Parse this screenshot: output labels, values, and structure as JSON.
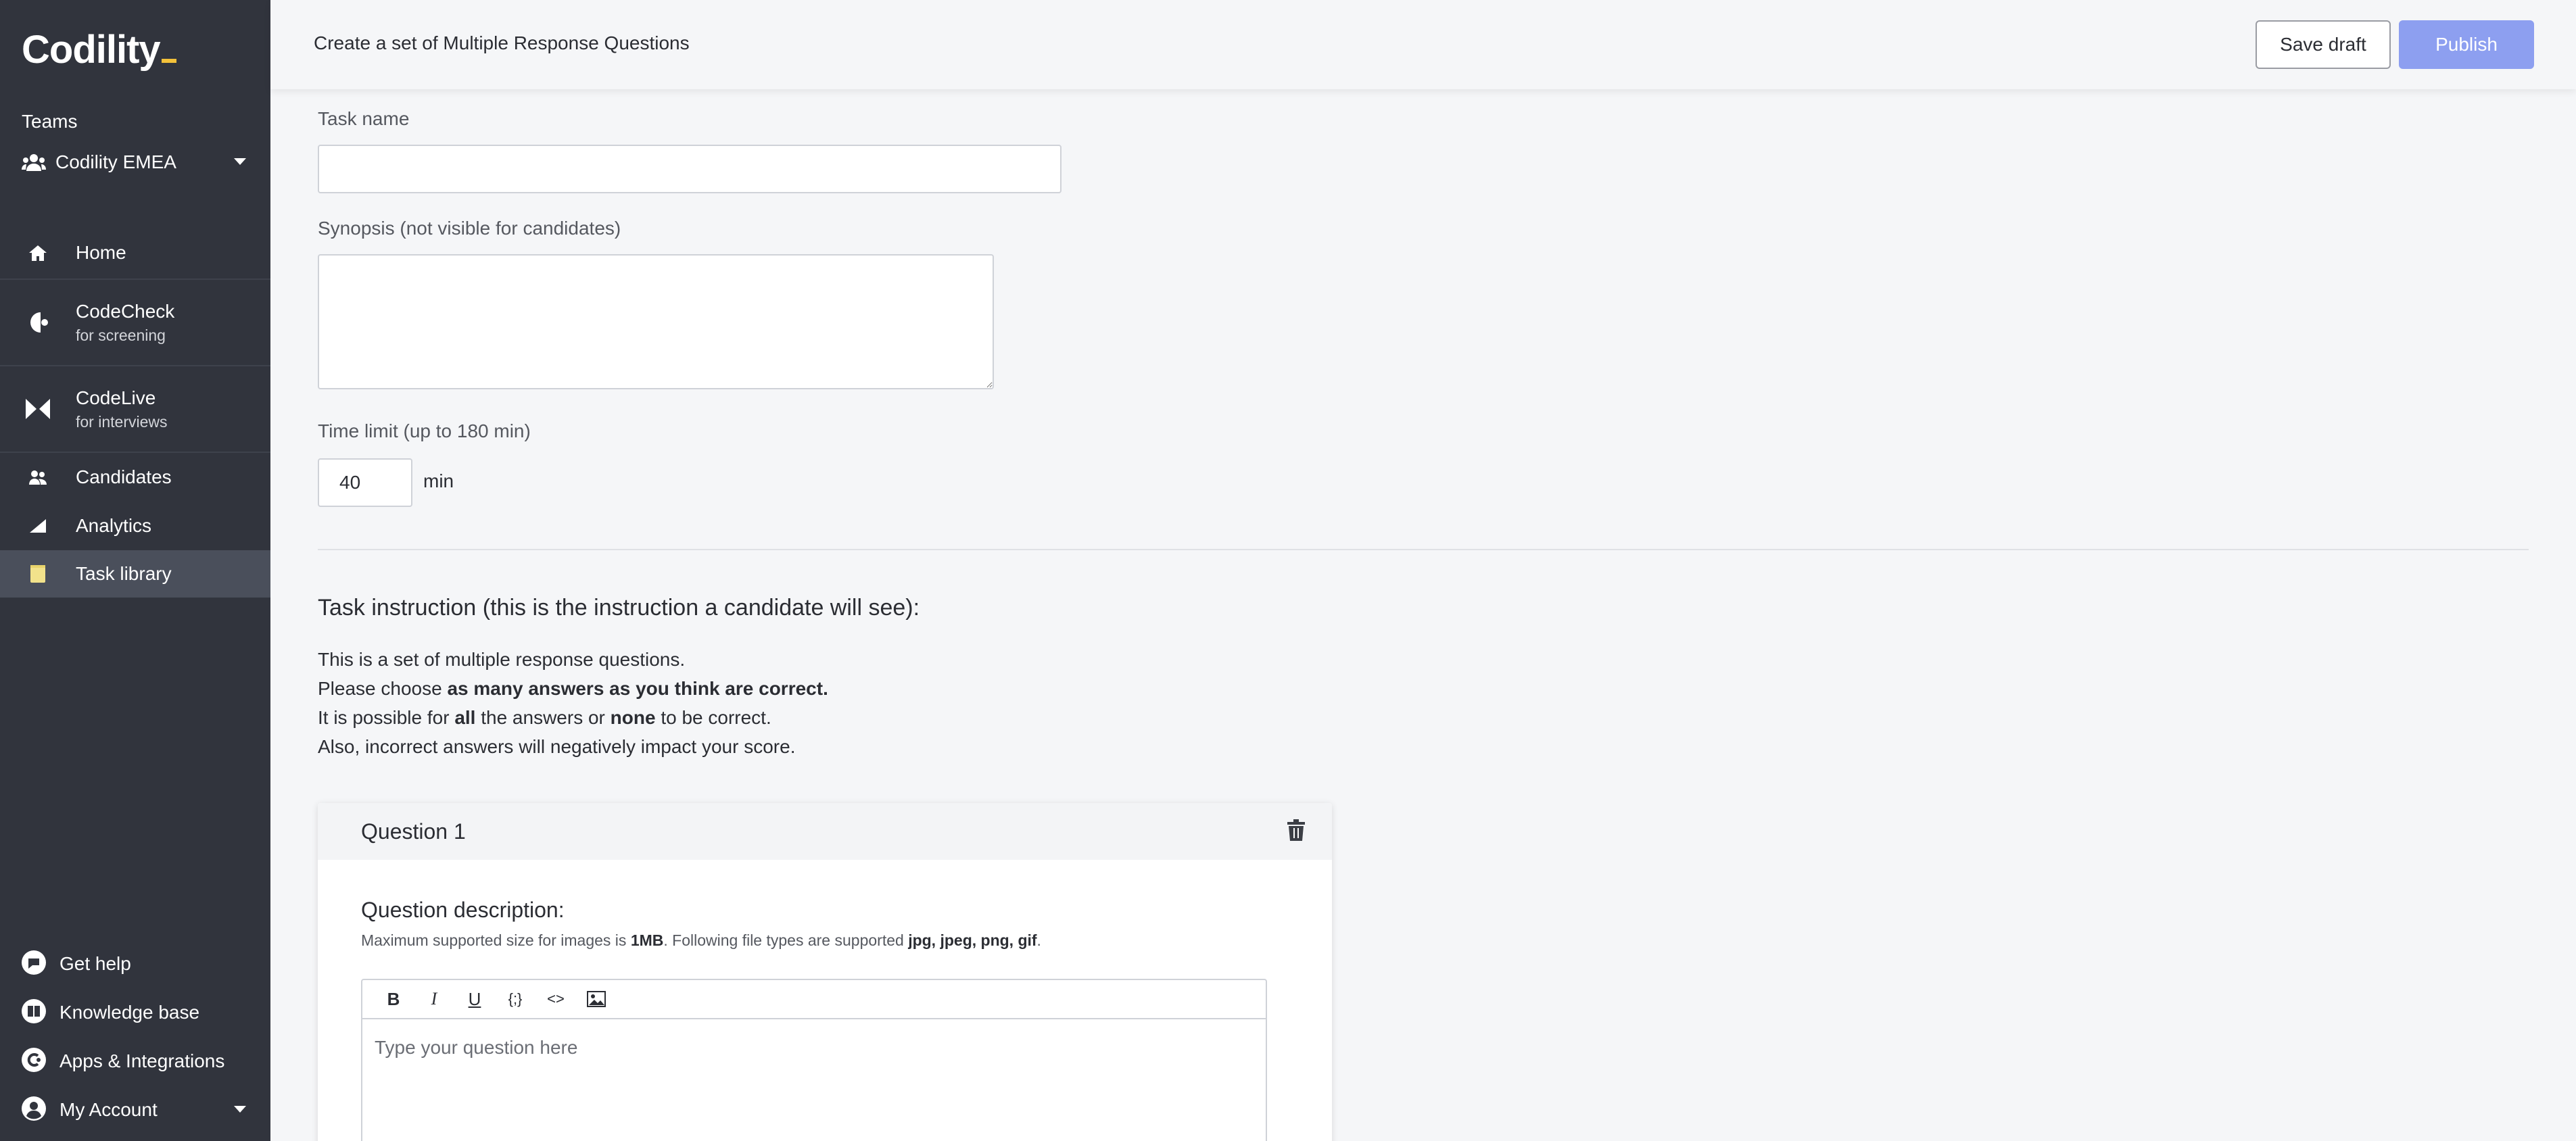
{
  "sidebar": {
    "logo": "Codility",
    "teams_label": "Teams",
    "team_name": "Codility EMEA",
    "nav": [
      {
        "label": "Home",
        "sub": ""
      },
      {
        "label": "CodeCheck",
        "sub": "for screening"
      },
      {
        "label": "CodeLive",
        "sub": "for interviews"
      },
      {
        "label": "Candidates",
        "sub": ""
      },
      {
        "label": "Analytics",
        "sub": ""
      },
      {
        "label": "Task library",
        "sub": ""
      }
    ],
    "footer": [
      {
        "label": "Get help"
      },
      {
        "label": "Knowledge base"
      },
      {
        "label": "Apps & Integrations"
      },
      {
        "label": "My Account"
      }
    ]
  },
  "header": {
    "title": "Create a set of Multiple Response Questions",
    "save_draft": "Save draft",
    "publish": "Publish"
  },
  "form": {
    "task_name_label": "Task name",
    "task_name_value": "",
    "synopsis_label": "Synopsis (not visible for candidates)",
    "synopsis_value": "",
    "time_limit_label": "Time limit (up to 180 min)",
    "time_limit_value": "40",
    "time_unit": "min"
  },
  "instruction": {
    "title": "Task instruction (this is the instruction a candidate will see):",
    "line1": "This is a set of multiple response questions.",
    "line2_pre": "Please choose ",
    "line2_bold": "as many answers as you think are correct.",
    "line3_pre": "It is possible for ",
    "line3_bold1": "all",
    "line3_mid": " the answers or ",
    "line3_bold2": "none",
    "line3_post": " to be correct.",
    "line4": "Also, incorrect answers will negatively impact your score."
  },
  "question": {
    "title": "Question 1",
    "desc_label": "Question description:",
    "note_pre": "Maximum supported size for images is ",
    "note_size": "1MB",
    "note_mid": ". Following file types are supported ",
    "note_types": "jpg, jpeg, png, gif",
    "note_post": ".",
    "toolbar": [
      "B",
      "I",
      "U",
      "{;}",
      "<>"
    ],
    "placeholder": "Type your question here"
  },
  "colors": {
    "sidebar_bg": "#31343d",
    "accent": "#8d9ff0",
    "logo_cursor": "#f3c13a",
    "task_library_icon": "#f2e28b"
  }
}
